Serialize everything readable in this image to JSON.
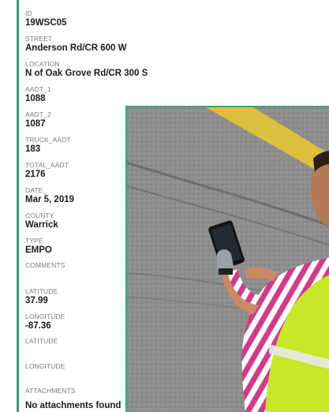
{
  "record": {
    "fields": [
      {
        "label": "ID",
        "value": "19WSC05"
      },
      {
        "label": "STREET",
        "value": "Anderson Rd/CR 600 W"
      },
      {
        "label": "LOCATION",
        "value": "N of Oak Grove Rd/CR 300 S"
      },
      {
        "label": "AADT_1",
        "value": "1088"
      },
      {
        "label": "AADT_2",
        "value": "1087"
      },
      {
        "label": "TRUCK_AADT",
        "value": "183"
      },
      {
        "label": "TOTAL_AADT",
        "value": "2176"
      },
      {
        "label": "DATE_",
        "value": "Mar 5, 2019"
      },
      {
        "label": "COUNTY",
        "value": "Warrick"
      },
      {
        "label": "TYPE",
        "value": "EMPO"
      },
      {
        "label": "COMMENTS",
        "value": ""
      },
      {
        "label": "LATITUDE",
        "value": "37.99"
      },
      {
        "label": "LONGITUDE",
        "value": "-87.36"
      },
      {
        "label": "LATITUDE",
        "value": ""
      },
      {
        "label": "LONGITUDE",
        "value": ""
      },
      {
        "label": "ATTACHMENTS",
        "value": ""
      }
    ],
    "attachments_message": "No attachments found"
  },
  "photo": {
    "subject": "worker-in-safety-vest-using-tablet-on-road"
  },
  "colors": {
    "accent": "#3a9b78",
    "label": "#7a7a7a",
    "value": "#1a1a1a",
    "vest": "#c8e62a",
    "road": "#8f8f8f",
    "road_stripe": "#e0c23a"
  }
}
